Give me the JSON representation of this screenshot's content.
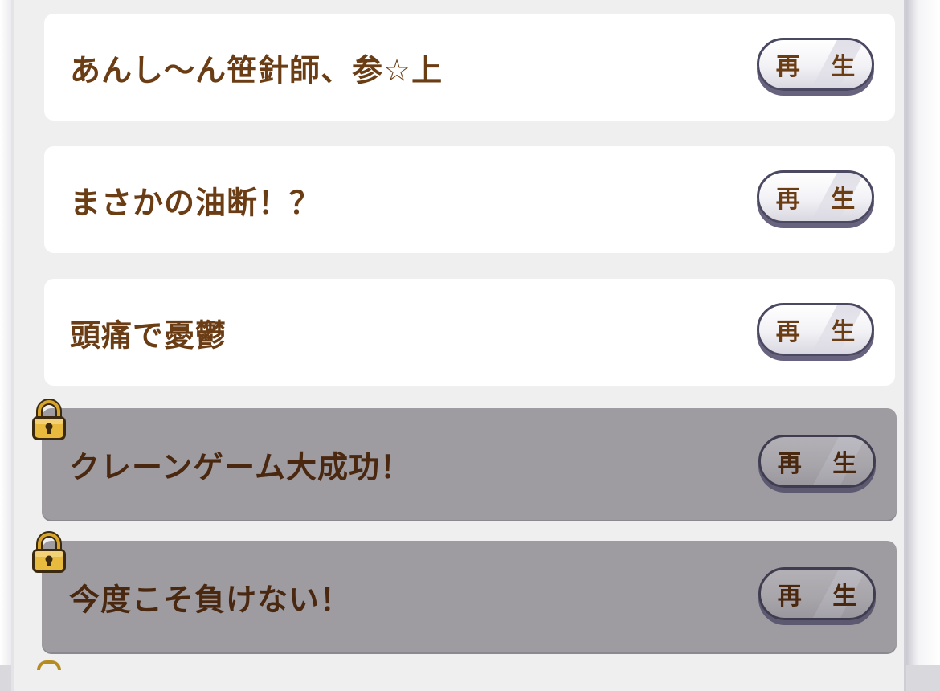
{
  "play_label": "再 生",
  "songs": [
    {
      "title": "あんし～ん笹針師、参☆上",
      "locked": false
    },
    {
      "title": "まさかの油断！？",
      "locked": false
    },
    {
      "title": "頭痛で憂鬱",
      "locked": false
    },
    {
      "title": "クレーンゲーム大成功！",
      "locked": true
    },
    {
      "title": "今度こそ負けない！",
      "locked": true
    }
  ],
  "colors": {
    "title_text": "#6b3d14",
    "locked_card": "#9e9ca1",
    "unlocked_card": "#ffffff",
    "lock_gold": "#e6b73a"
  },
  "icons": {
    "lock": "padlock-icon"
  }
}
